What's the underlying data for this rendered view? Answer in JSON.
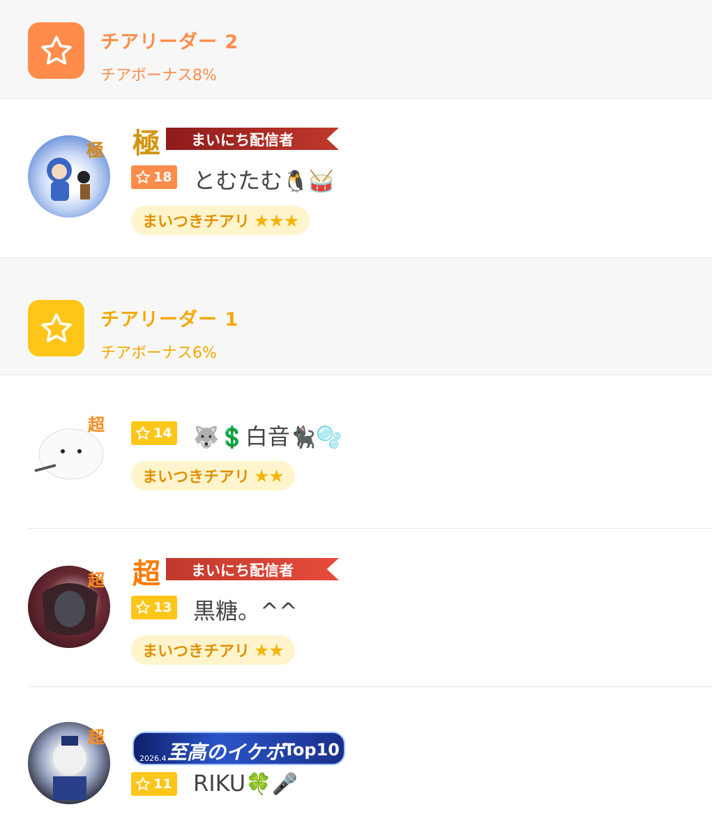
{
  "sections": [
    {
      "title": "チアリーダー 2",
      "bonus": "チアボーナス8%",
      "color": "#ff8c4a",
      "icon": "star-outline-icon"
    },
    {
      "title": "チアリーダー 1",
      "bonus": "チアボーナス6%",
      "color": "#ffc107",
      "icon": "star-outline-icon"
    }
  ],
  "users": [
    {
      "level": "18",
      "name": "とむたむ",
      "emoji": "🐧🥁",
      "badge_kanji": "極",
      "banner_kanji": "極",
      "banner_text": "まいにち配信者",
      "pill": "まいつきチアリ",
      "stars": "★★★",
      "level_color": "#ff8c4a"
    },
    {
      "level": "14",
      "name": "白音",
      "prefix_emoji": "🐺💲",
      "emoji": "🐈‍⬛🫧",
      "badge_kanji": "超",
      "pill": "まいつきチアリ",
      "stars": "★★",
      "level_color": "#ffc107"
    },
    {
      "level": "13",
      "name": "黒糖。^^",
      "badge_kanji": "超",
      "banner_kanji": "超",
      "banner_text": "まいにち配信者",
      "pill": "まいつきチアリ",
      "stars": "★★",
      "level_color": "#ffc107"
    },
    {
      "level": "11",
      "name": "RIKU",
      "emoji": "🍀🎤",
      "badge_kanji": "超",
      "ikebo_date": "2026.4",
      "ikebo_title": "至高のイケボ",
      "ikebo_top": "Top10",
      "level_color": "#ffc107"
    }
  ]
}
